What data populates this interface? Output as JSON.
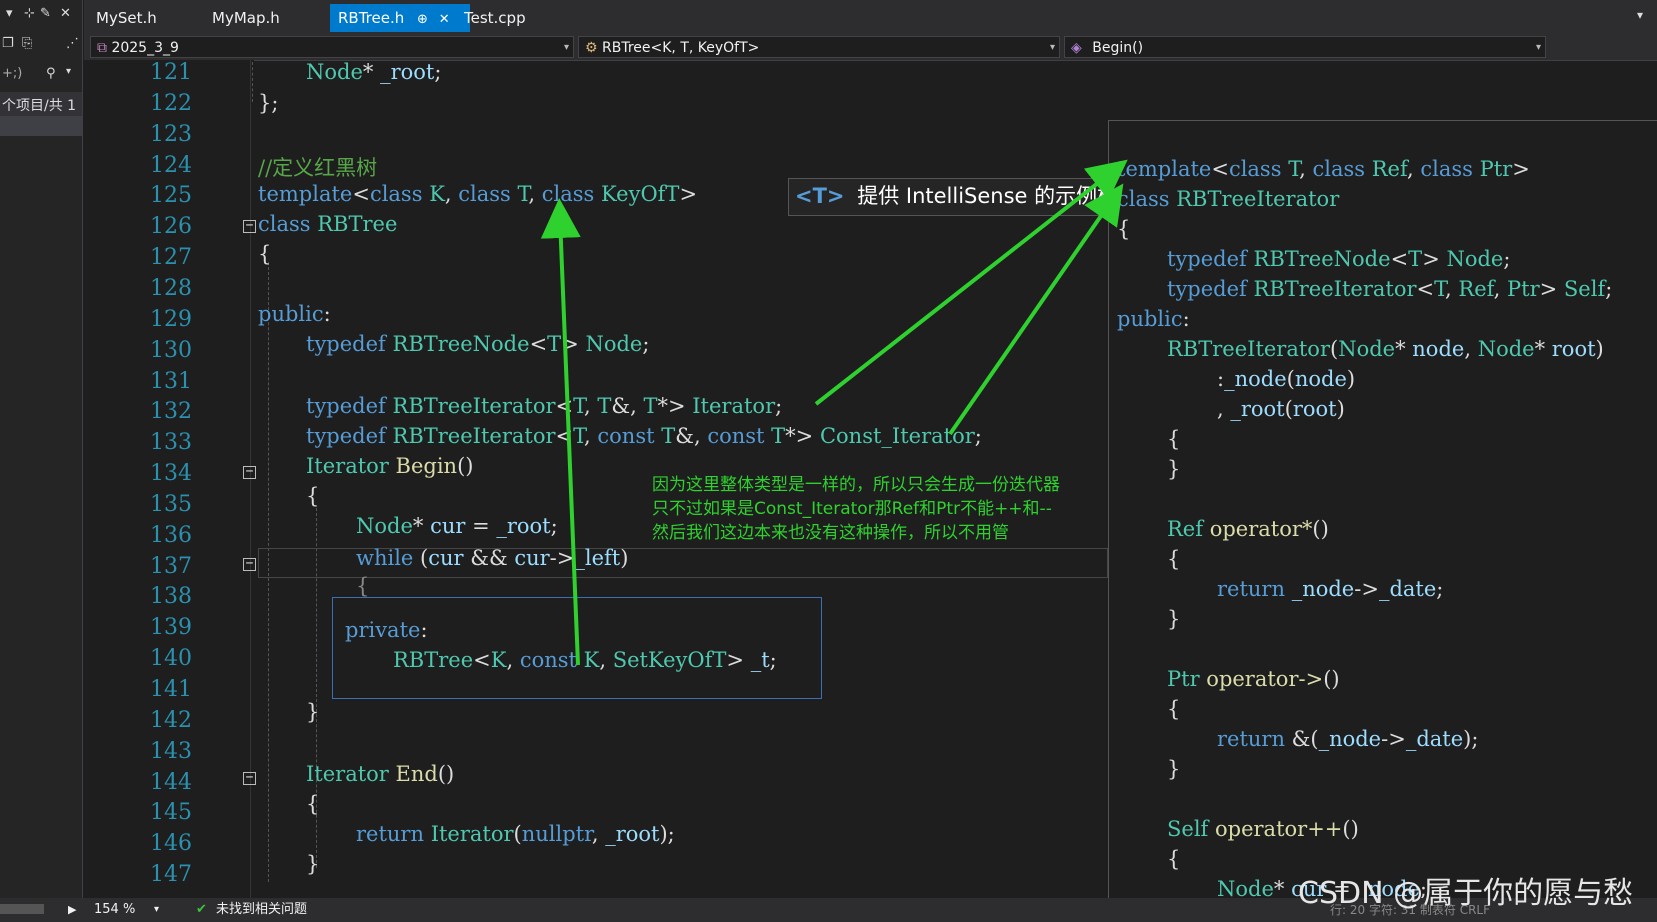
{
  "left_panel": {
    "toolbar_glyphs": [
      "▾",
      "⊹",
      "✕"
    ],
    "search_hint": "+;)",
    "project_label": "个项目/共 1"
  },
  "tabs": [
    {
      "label": "MySet.h"
    },
    {
      "label": "MyMap.h"
    },
    {
      "label": "RBTree.h",
      "pin": "⊕",
      "close": "✕"
    },
    {
      "label": "Test.cpp"
    }
  ],
  "navbar": {
    "project": "2025_3_9",
    "scope": "RBTree<K, T, KeyOfT>",
    "member": "Begin()"
  },
  "editor": {
    "line_numbers": [
      "121",
      "122",
      "123",
      "124",
      "125",
      "126",
      "127",
      "128",
      "129",
      "130",
      "131",
      "132",
      "133",
      "134",
      "135",
      "136",
      "137",
      "138",
      "139",
      "140",
      "141",
      "142",
      "143",
      "144",
      "145",
      "146",
      "147"
    ]
  },
  "tooltip": {
    "badge": "<T>",
    "text": "提供 IntelliSense 的示例模"
  },
  "annotation": {
    "line1": "因为这里整体类型是一样的，所以只会生成一份迭代器",
    "line2": "只不过如果是Const_Iterator那Ref和Ptr不能++和--",
    "line3": "然后我们这边本来也没有这种操作，所以不用管"
  },
  "status": {
    "zoom": "154 %",
    "issues": "未找到相关问题",
    "right_text": "行: 20  字符: 31  制表符  CRLF"
  },
  "watermark": "CSDN @属于你的愿与愁",
  "colors": {
    "keyword": "#569cd6",
    "type": "#4ec9b0",
    "function": "#dcdcaa",
    "comment": "#57a64a",
    "annotation": "#2fd12f",
    "accent": "#007acc"
  }
}
